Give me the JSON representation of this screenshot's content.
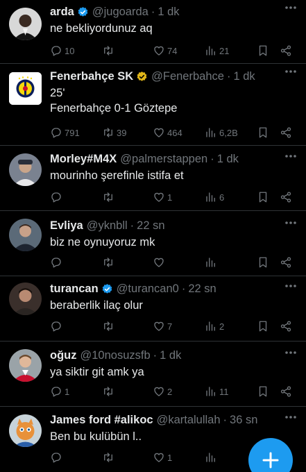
{
  "colors": {
    "background": "#000000",
    "text": "#e7e9ea",
    "muted": "#71767b",
    "accent": "#1d9bf0",
    "verified_blue": "#1d9bf0",
    "verified_gold": "#e2b719"
  },
  "tweets": [
    {
      "name": "arda",
      "verified": "blue",
      "handle": "@jugoarda",
      "time": "1 dk",
      "text": "ne bekliyordunuz aq",
      "replies": "10",
      "retweets": "",
      "likes": "74",
      "views": "21"
    },
    {
      "name": "Fenerbahçe SK",
      "verified": "gold",
      "handle": "@Fenerbahce",
      "time": "1 dk",
      "text": "25'\nFenerbahçe 0-1 Göztepe",
      "replies": "791",
      "retweets": "39",
      "likes": "464",
      "views": "6,2B"
    },
    {
      "name": "Morley#M4X",
      "verified": "",
      "handle": "@palmerstappen",
      "time": "1 dk",
      "text": "mourinho şerefinle istifa et",
      "replies": "",
      "retweets": "",
      "likes": "1",
      "views": "6"
    },
    {
      "name": "Evliya",
      "verified": "",
      "handle": "@yknbll",
      "time": "22 sn",
      "text": "biz ne oynuyoruz mk",
      "replies": "",
      "retweets": "",
      "likes": "",
      "views": ""
    },
    {
      "name": "turancan",
      "verified": "blue",
      "handle": "@turancan0",
      "time": "22 sn",
      "text": "beraberlik ilaç olur",
      "replies": "",
      "retweets": "",
      "likes": "7",
      "views": "2"
    },
    {
      "name": "oğuz",
      "verified": "",
      "handle": "@10nosuzsfb",
      "time": "1 dk",
      "text": "ya siktir git amk ya",
      "replies": "1",
      "retweets": "",
      "likes": "2",
      "views": "11"
    },
    {
      "name": "James ford #alikoc",
      "verified": "",
      "handle": "@kartalullah",
      "time": "36 sn",
      "text": "Ben bu kulübün l..",
      "replies": "",
      "retweets": "",
      "likes": "1",
      "views": ""
    }
  ],
  "fab": {
    "icon": "plus-icon"
  }
}
